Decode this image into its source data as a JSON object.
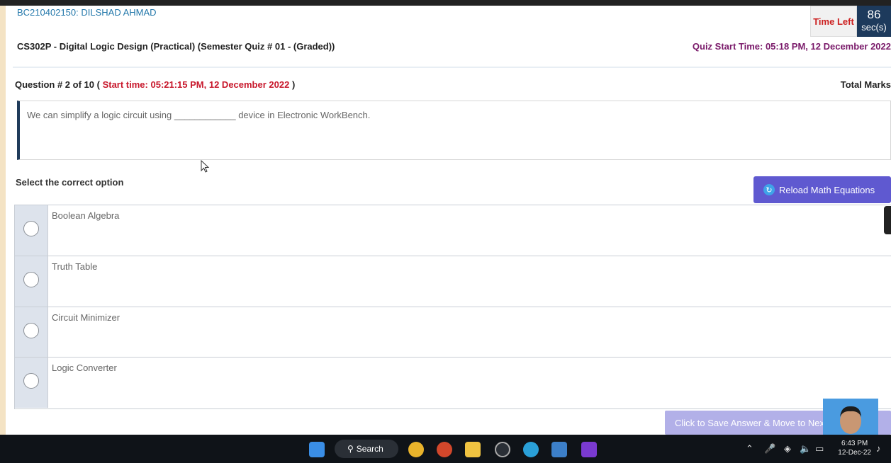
{
  "header": {
    "student": "BC210402150: DILSHAD AHMAD",
    "timer_label": "Time Left",
    "timer_value": "86",
    "timer_unit": "sec(s)",
    "course_title": "CS302P - Digital Logic Design (Practical) (Semester Quiz # 01 - (Graded))",
    "quiz_start": "Quiz Start Time: 05:18 PM, 12 December 2022"
  },
  "question": {
    "number": "Question # 2 of 10",
    "open_paren": "(",
    "start_time": "Start time: 05:21:15 PM, 12 December 2022",
    "close_paren": ")",
    "total_marks_label": "Total Marks",
    "text": "We can simplify a logic circuit using ____________ device in Electronic WorkBench."
  },
  "select_label": "Select the correct option",
  "reload_button": "Reload Math Equations",
  "options": [
    {
      "label": "Boolean Algebra"
    },
    {
      "label": "Truth Table"
    },
    {
      "label": "Circuit Minimizer"
    },
    {
      "label": "Logic Converter"
    }
  ],
  "save_button": "Click to Save Answer & Move to Next Question",
  "taskbar": {
    "search_label": "Search",
    "time": "6:43 PM",
    "date": "12-Dec-22"
  },
  "colors": {
    "accent": "#5f59d0",
    "timer_bg": "#1d3a5c",
    "start_time_red": "#c8182c",
    "quiz_start_purple": "#7a1a6a"
  }
}
